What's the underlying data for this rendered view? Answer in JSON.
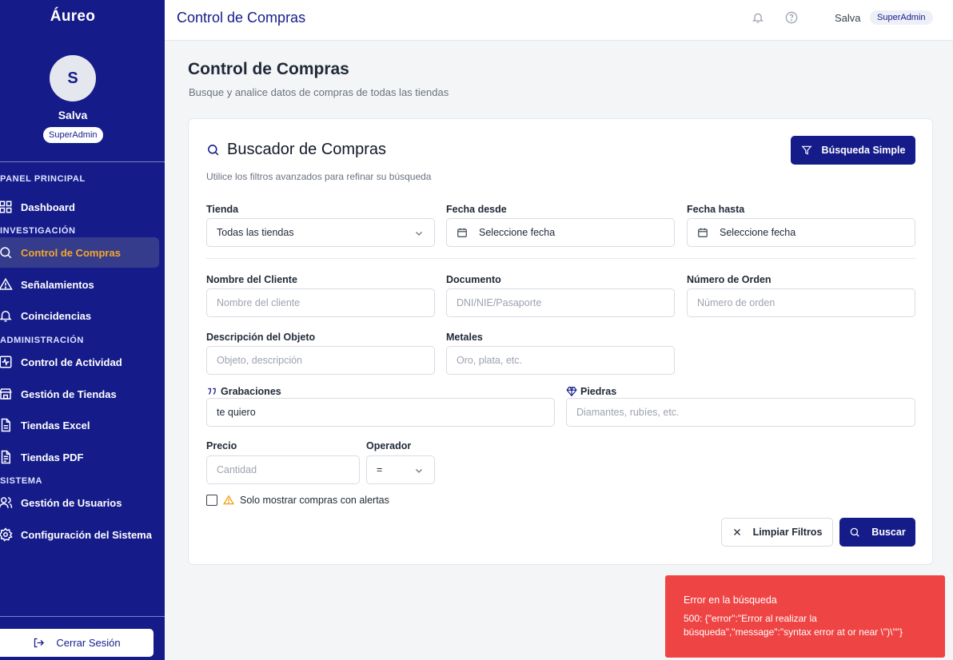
{
  "app": {
    "brand": "Áureo"
  },
  "user": {
    "initial": "S",
    "name": "Salva",
    "role": "SuperAdmin"
  },
  "sidebar": {
    "sections": [
      {
        "title": "PANEL PRINCIPAL"
      },
      {
        "title": "INVESTIGACIÓN"
      },
      {
        "title": "ADMINISTRACIÓN"
      },
      {
        "title": "SISTEMA"
      }
    ],
    "items": [
      {
        "label": "Dashboard",
        "icon": "grid-icon"
      },
      {
        "label": "Control de Compras",
        "icon": "search-icon",
        "active": true
      },
      {
        "label": "Señalamientos",
        "icon": "alert-triangle-icon"
      },
      {
        "label": "Coincidencias",
        "icon": "bell-icon"
      },
      {
        "label": "Control de Actividad",
        "icon": "activity-icon"
      },
      {
        "label": "Gestión de Tiendas",
        "icon": "store-icon"
      },
      {
        "label": "Tiendas Excel",
        "icon": "file-icon"
      },
      {
        "label": "Tiendas PDF",
        "icon": "file-text-icon"
      },
      {
        "label": "Gestión de Usuarios",
        "icon": "users-icon"
      },
      {
        "label": "Configuración del Sistema",
        "icon": "gear-icon"
      }
    ],
    "logout": "Cerrar Sesión"
  },
  "topbar": {
    "title": "Control de Compras",
    "user": "Salva",
    "role": "SuperAdmin"
  },
  "page": {
    "title": "Control de Compras",
    "subtitle": "Busque y analice datos de compras de todas las tiendas"
  },
  "search": {
    "title": "Buscador de Compras",
    "subtitle": "Utilice los filtros avanzados para refinar su búsqueda",
    "simple_button": "Búsqueda Simple",
    "fields": {
      "tienda": {
        "label": "Tienda",
        "value": "Todas las tiendas"
      },
      "fecha_desde": {
        "label": "Fecha desde",
        "value": "Seleccione fecha"
      },
      "fecha_hasta": {
        "label": "Fecha hasta",
        "value": "Seleccione fecha"
      },
      "nombre": {
        "label": "Nombre del Cliente",
        "placeholder": "Nombre del cliente"
      },
      "documento": {
        "label": "Documento",
        "placeholder": "DNI/NIE/Pasaporte"
      },
      "orden": {
        "label": "Número de Orden",
        "placeholder": "Número de orden"
      },
      "descripcion": {
        "label": "Descripción del Objeto",
        "placeholder": "Objeto, descripción"
      },
      "metales": {
        "label": "Metales",
        "placeholder": "Oro, plata, etc."
      },
      "grabaciones": {
        "label": "Grabaciones",
        "value": "te quiero"
      },
      "piedras": {
        "label": "Piedras",
        "placeholder": "Diamantes, rubíes, etc."
      },
      "precio": {
        "label": "Precio",
        "placeholder": "Cantidad"
      },
      "operador": {
        "label": "Operador",
        "value": "="
      }
    },
    "alerts_checkbox": "Solo mostrar compras con alertas",
    "clear_button": "Limpiar Filtros",
    "search_button": "Buscar"
  },
  "toast": {
    "title": "Error en la búsqueda",
    "message": "500: {\"error\":\"Error al realizar la búsqueda\",\"message\":\"syntax error at or near \\\")\\\"\"}"
  },
  "colors": {
    "primary": "#151c8a",
    "active": "#f4a62a",
    "error": "#ef4444"
  }
}
